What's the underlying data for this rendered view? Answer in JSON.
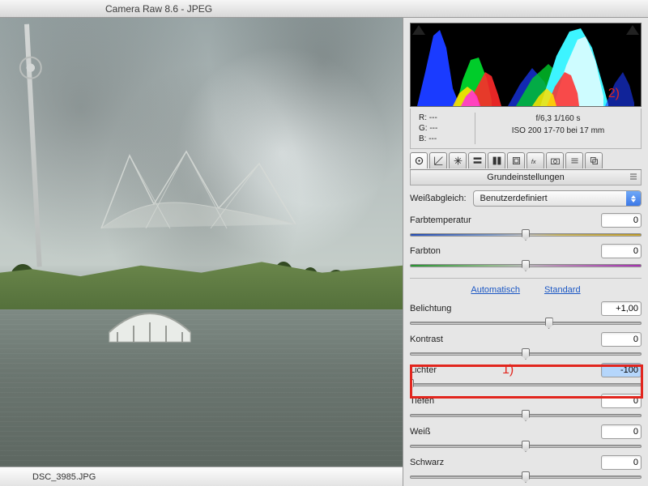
{
  "title": "Camera Raw 8.6 - JPEG",
  "filename": "DSC_3985.JPG",
  "exif": {
    "r": "R:   ---",
    "g": "G:   ---",
    "b": "B:   ---",
    "aperture_shutter": "f/6,3   1/160 s",
    "iso_lens": "ISO 200   17-70 bei 17 mm"
  },
  "panel_title": "Grundeinstellungen",
  "wb": {
    "label": "Weißabgleich:",
    "value": "Benutzerdefiniert"
  },
  "links": {
    "auto": "Automatisch",
    "default": "Standard"
  },
  "sliders": {
    "temp": {
      "label": "Farbtemperatur",
      "value": "0",
      "pos": 50
    },
    "tint": {
      "label": "Farbton",
      "value": "0",
      "pos": 50
    },
    "exposure": {
      "label": "Belichtung",
      "value": "+1,00",
      "pos": 60
    },
    "contrast": {
      "label": "Kontrast",
      "value": "0",
      "pos": 50
    },
    "lights": {
      "label": "Lichter",
      "value": "-100",
      "pos": 0
    },
    "shadows": {
      "label": "Tiefen",
      "value": "0",
      "pos": 50
    },
    "whites": {
      "label": "Weiß",
      "value": "0",
      "pos": 50
    },
    "blacks": {
      "label": "Schwarz",
      "value": "0",
      "pos": 50
    }
  },
  "annotations": {
    "one": "1)",
    "two": "2)"
  }
}
